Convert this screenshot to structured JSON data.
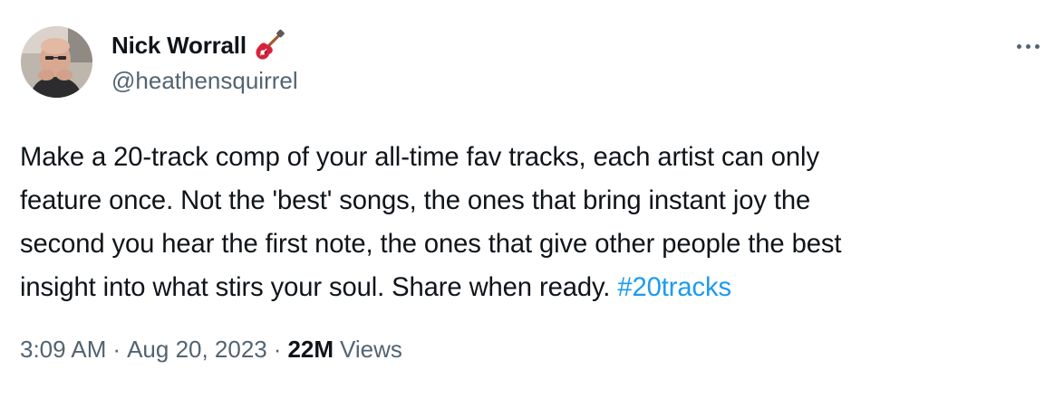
{
  "author": {
    "display_name": "Nick Worrall",
    "handle": "@heathensquirrel",
    "badge_icon": "guitar-icon"
  },
  "tweet": {
    "lines": [
      "Make a 20-track comp of your all-time fav tracks, each artist can only",
      "feature once. Not the 'best' songs, the ones that bring instant joy the",
      "second you hear the first note, the ones that give other people the best",
      "insight into what stirs your soul. Share when ready. "
    ],
    "hashtag": "#20tracks"
  },
  "meta": {
    "time": "3:09 AM",
    "separator": "·",
    "date": "Aug 20, 2023",
    "views_count": "22M",
    "views_label": "Views"
  },
  "colors": {
    "text": "#0f1419",
    "secondary": "#536471",
    "link": "#1d9bf0"
  },
  "icons": {
    "more": "more-horizontal-icon"
  }
}
